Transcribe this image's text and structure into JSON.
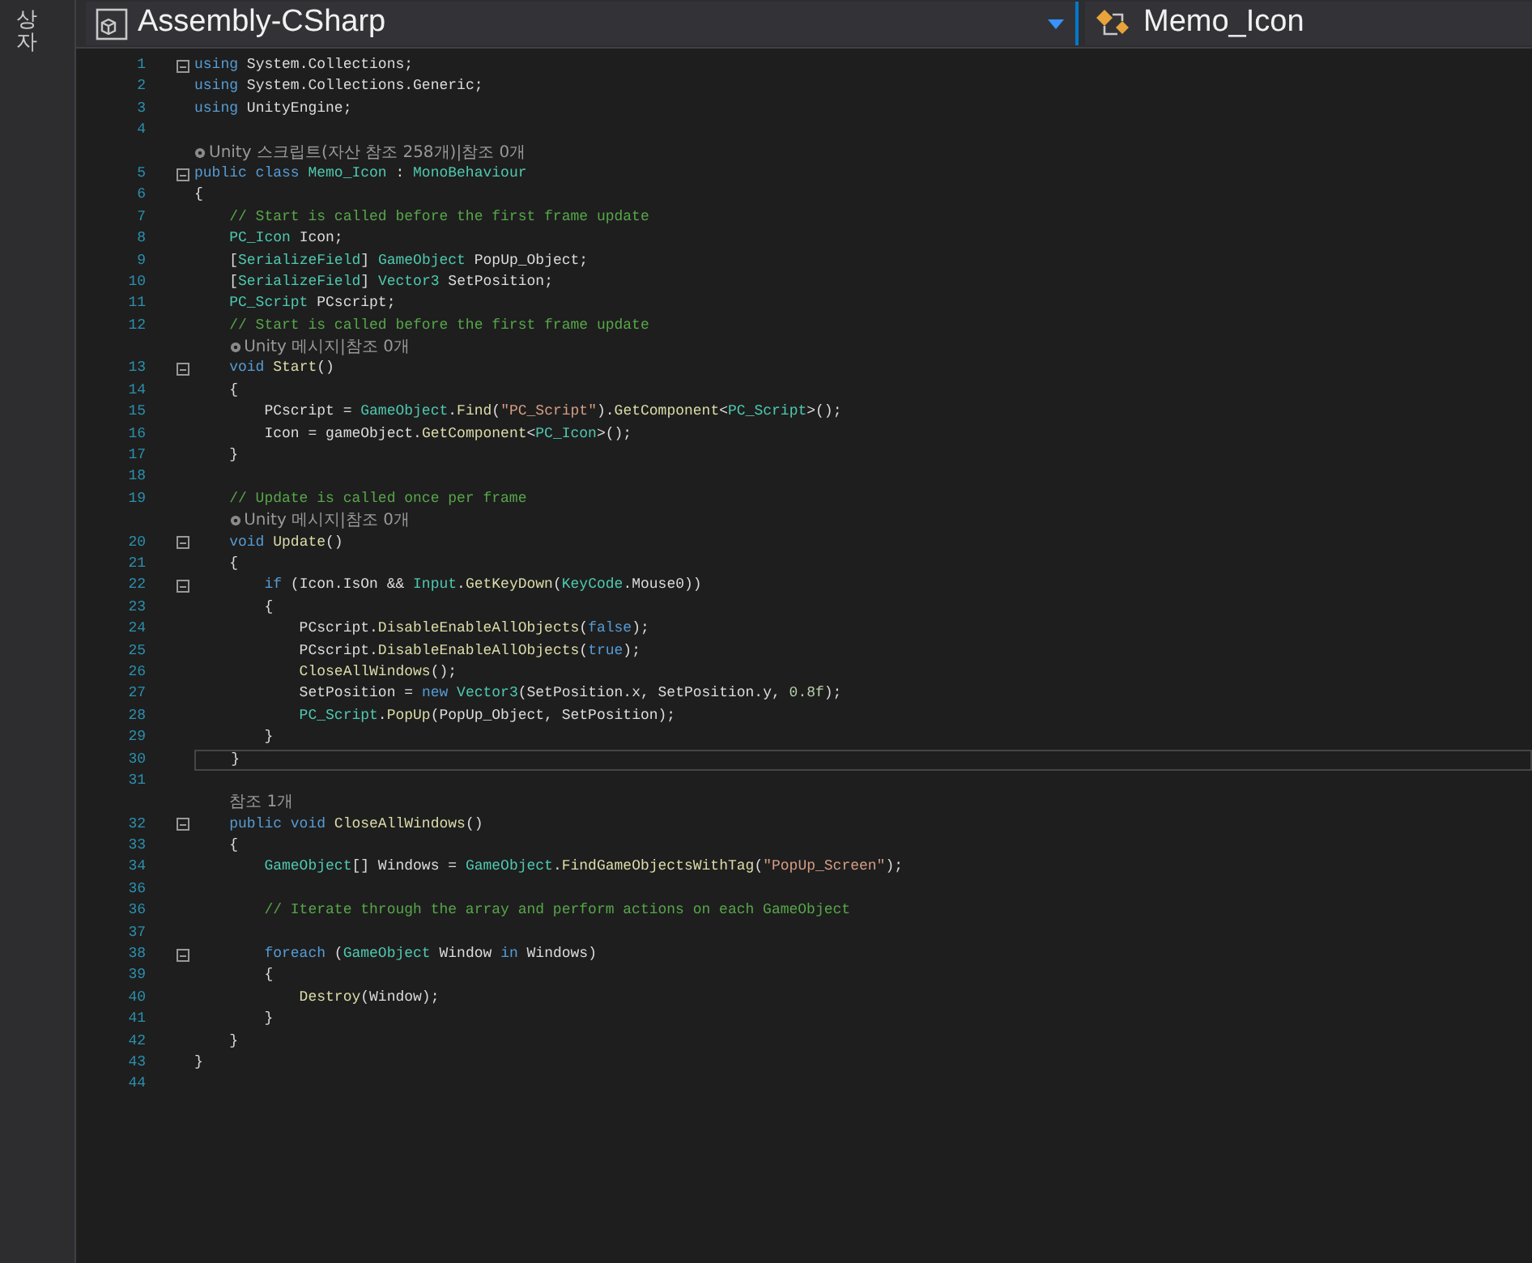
{
  "side_tab": {
    "label": "상자"
  },
  "toolbar": {
    "project": "Assembly-CSharp",
    "class": "Memo_Icon"
  },
  "lines": [
    {
      "number": "1",
      "fold": true,
      "tokens": [
        {
          "text": "using",
          "kind": "keyword"
        },
        {
          "text": " System.Collections;",
          "kind": "plain"
        }
      ]
    },
    {
      "number": "2",
      "tokens": [
        {
          "text": "using",
          "kind": "keyword"
        },
        {
          "text": " System.Collections.Generic;",
          "kind": "plain"
        }
      ]
    },
    {
      "number": "3",
      "tokens": [
        {
          "text": "using",
          "kind": "keyword"
        },
        {
          "text": " UnityEngine;",
          "kind": "plain"
        }
      ]
    },
    {
      "number": "4"
    },
    {
      "kind": "codelens",
      "icon": true,
      "text": "Unity 스크립트(자산 참조 258개)|참조 0개"
    },
    {
      "number": "5",
      "fold": true,
      "tokens": [
        {
          "text": "public class",
          "kind": "keyword"
        },
        {
          "text": " Memo_Icon",
          "kind": "type"
        },
        {
          "text": " : ",
          "kind": "plain"
        },
        {
          "text": "MonoBehaviour",
          "kind": "type"
        }
      ]
    },
    {
      "number": "6",
      "tokens": [
        {
          "text": "{",
          "kind": "plain"
        }
      ]
    },
    {
      "number": "7",
      "tokens": [
        {
          "text": "    // Start is called before the first frame update",
          "kind": "comment"
        }
      ]
    },
    {
      "number": "8",
      "tokens": [
        {
          "text": "    PC_Icon",
          "kind": "type"
        },
        {
          "text": " Icon;",
          "kind": "plain"
        }
      ]
    },
    {
      "number": "9",
      "tokens": [
        {
          "text": "    [",
          "kind": "plain"
        },
        {
          "text": "SerializeField",
          "kind": "type"
        },
        {
          "text": "] ",
          "kind": "plain"
        },
        {
          "text": "GameObject",
          "kind": "type"
        },
        {
          "text": " PopUp_Object;",
          "kind": "plain"
        }
      ]
    },
    {
      "number": "10",
      "tokens": [
        {
          "text": "    [",
          "kind": "plain"
        },
        {
          "text": "SerializeField",
          "kind": "type"
        },
        {
          "text": "] ",
          "kind": "plain"
        },
        {
          "text": "Vector3",
          "kind": "type"
        },
        {
          "text": " SetPosition;",
          "kind": "plain"
        }
      ]
    },
    {
      "number": "11",
      "tokens": [
        {
          "text": "    PC_Script",
          "kind": "type"
        },
        {
          "text": " PCscript;",
          "kind": "plain"
        }
      ]
    },
    {
      "number": "12",
      "tokens": [
        {
          "text": "    // Start is called before the first frame update",
          "kind": "comment"
        }
      ]
    },
    {
      "kind": "codelens",
      "icon": true,
      "text": "Unity 메시지|참조 0개"
    },
    {
      "number": "13",
      "fold": true,
      "tokens": [
        {
          "text": "    void",
          "kind": "keyword"
        },
        {
          "text": " Start",
          "kind": "method"
        },
        {
          "text": "()",
          "kind": "plain"
        }
      ]
    },
    {
      "number": "14",
      "tokens": [
        {
          "text": "    {",
          "kind": "plain"
        }
      ]
    },
    {
      "number": "15",
      "tokens": [
        {
          "text": "        PCscript = ",
          "kind": "plain"
        },
        {
          "text": "GameObject",
          "kind": "type"
        },
        {
          "text": ".",
          "kind": "plain"
        },
        {
          "text": "Find",
          "kind": "method"
        },
        {
          "text": "(",
          "kind": "plain"
        },
        {
          "text": "\"PC_Script\"",
          "kind": "string"
        },
        {
          "text": ").",
          "kind": "plain"
        },
        {
          "text": "GetComponent",
          "kind": "method"
        },
        {
          "text": "<",
          "kind": "plain"
        },
        {
          "text": "PC_Script",
          "kind": "type"
        },
        {
          "text": ">();",
          "kind": "plain"
        }
      ]
    },
    {
      "number": "16",
      "tokens": [
        {
          "text": "        Icon = gameObject.",
          "kind": "plain"
        },
        {
          "text": "GetComponent",
          "kind": "method"
        },
        {
          "text": "<",
          "kind": "plain"
        },
        {
          "text": "PC_Icon",
          "kind": "type"
        },
        {
          "text": ">();",
          "kind": "plain"
        }
      ]
    },
    {
      "number": "17",
      "tokens": [
        {
          "text": "    }",
          "kind": "plain"
        }
      ]
    },
    {
      "number": "18"
    },
    {
      "number": "19",
      "tokens": [
        {
          "text": "    // Update is called once per frame",
          "kind": "comment"
        }
      ]
    },
    {
      "kind": "codelens",
      "icon": true,
      "text": "Unity 메시지|참조 0개"
    },
    {
      "number": "20",
      "fold": true,
      "tokens": [
        {
          "text": "    void",
          "kind": "keyword"
        },
        {
          "text": " Update",
          "kind": "method"
        },
        {
          "text": "()",
          "kind": "plain"
        }
      ]
    },
    {
      "number": "21",
      "tokens": [
        {
          "text": "    {",
          "kind": "plain"
        }
      ]
    },
    {
      "number": "22",
      "fold": true,
      "tokens": [
        {
          "text": "        if",
          "kind": "keyword"
        },
        {
          "text": " (Icon.IsOn && ",
          "kind": "plain"
        },
        {
          "text": "Input",
          "kind": "type"
        },
        {
          "text": ".",
          "kind": "plain"
        },
        {
          "text": "GetKeyDown",
          "kind": "method"
        },
        {
          "text": "(",
          "kind": "plain"
        },
        {
          "text": "KeyCode",
          "kind": "type"
        },
        {
          "text": ".Mouse0))",
          "kind": "plain"
        }
      ]
    },
    {
      "number": "23",
      "tokens": [
        {
          "text": "        {",
          "kind": "plain"
        }
      ]
    },
    {
      "number": "24",
      "tokens": [
        {
          "text": "            PCscript.",
          "kind": "plain"
        },
        {
          "text": "DisableEnableAllObjects",
          "kind": "method"
        },
        {
          "text": "(",
          "kind": "plain"
        },
        {
          "text": "false",
          "kind": "keyword"
        },
        {
          "text": ");",
          "kind": "plain"
        }
      ]
    },
    {
      "number": "25",
      "tokens": [
        {
          "text": "            PCscript.",
          "kind": "plain"
        },
        {
          "text": "DisableEnableAllObjects",
          "kind": "method"
        },
        {
          "text": "(",
          "kind": "plain"
        },
        {
          "text": "true",
          "kind": "keyword"
        },
        {
          "text": ");",
          "kind": "plain"
        }
      ]
    },
    {
      "number": "26",
      "tokens": [
        {
          "text": "            CloseAllWindows",
          "kind": "method"
        },
        {
          "text": "();",
          "kind": "plain"
        }
      ]
    },
    {
      "number": "27",
      "tokens": [
        {
          "text": "            SetPosition = ",
          "kind": "plain"
        },
        {
          "text": "new",
          "kind": "keyword"
        },
        {
          "text": " Vector3",
          "kind": "type"
        },
        {
          "text": "(SetPosition.x, SetPosition.y, ",
          "kind": "plain"
        },
        {
          "text": "0.8f",
          "kind": "number"
        },
        {
          "text": ");",
          "kind": "plain"
        }
      ]
    },
    {
      "number": "28",
      "tokens": [
        {
          "text": "            PC_Script",
          "kind": "type"
        },
        {
          "text": ".",
          "kind": "plain"
        },
        {
          "text": "PopUp",
          "kind": "method"
        },
        {
          "text": "(PopUp_Object, SetPosition);",
          "kind": "plain"
        }
      ]
    },
    {
      "number": "29",
      "tokens": [
        {
          "text": "        }",
          "kind": "plain"
        }
      ]
    },
    {
      "number": "30",
      "current": true,
      "tokens": [
        {
          "text": "    }",
          "kind": "plain"
        }
      ]
    },
    {
      "number": "31"
    },
    {
      "kind": "codelens",
      "icon": false,
      "text": "참조 1개"
    },
    {
      "number": "32",
      "fold": true,
      "tokens": [
        {
          "text": "    public void",
          "kind": "keyword"
        },
        {
          "text": " CloseAllWindows",
          "kind": "method"
        },
        {
          "text": "()",
          "kind": "plain"
        }
      ]
    },
    {
      "number": "33",
      "tokens": [
        {
          "text": "    {",
          "kind": "plain"
        }
      ]
    },
    {
      "number": "34",
      "tokens": [
        {
          "text": "        GameObject",
          "kind": "type"
        },
        {
          "text": "[] Windows = ",
          "kind": "plain"
        },
        {
          "text": "GameObject",
          "kind": "type"
        },
        {
          "text": ".",
          "kind": "plain"
        },
        {
          "text": "FindGameObjectsWithTag",
          "kind": "method"
        },
        {
          "text": "(",
          "kind": "plain"
        },
        {
          "text": "\"PopUp_Screen\"",
          "kind": "string"
        },
        {
          "text": ");",
          "kind": "plain"
        }
      ]
    },
    {
      "number": "36"
    },
    {
      "number": "36",
      "tokens": [
        {
          "text": "        // Iterate through the array and perform actions on each GameObject",
          "kind": "comment"
        }
      ]
    },
    {
      "number": "37"
    },
    {
      "number": "38",
      "fold": true,
      "tokens": [
        {
          "text": "        foreach",
          "kind": "keyword"
        },
        {
          "text": " (",
          "kind": "plain"
        },
        {
          "text": "GameObject",
          "kind": "type"
        },
        {
          "text": " Window ",
          "kind": "plain"
        },
        {
          "text": "in",
          "kind": "keyword"
        },
        {
          "text": " Windows)",
          "kind": "plain"
        }
      ]
    },
    {
      "number": "39",
      "tokens": [
        {
          "text": "        {",
          "kind": "plain"
        }
      ]
    },
    {
      "number": "40",
      "tokens": [
        {
          "text": "            Destroy",
          "kind": "method"
        },
        {
          "text": "(Window);",
          "kind": "plain"
        }
      ]
    },
    {
      "number": "41",
      "tokens": [
        {
          "text": "        }",
          "kind": "plain"
        }
      ]
    },
    {
      "number": "42",
      "tokens": [
        {
          "text": "    }",
          "kind": "plain"
        }
      ]
    },
    {
      "number": "43",
      "tokens": [
        {
          "text": "}",
          "kind": "plain"
        }
      ]
    },
    {
      "number": "44"
    }
  ]
}
